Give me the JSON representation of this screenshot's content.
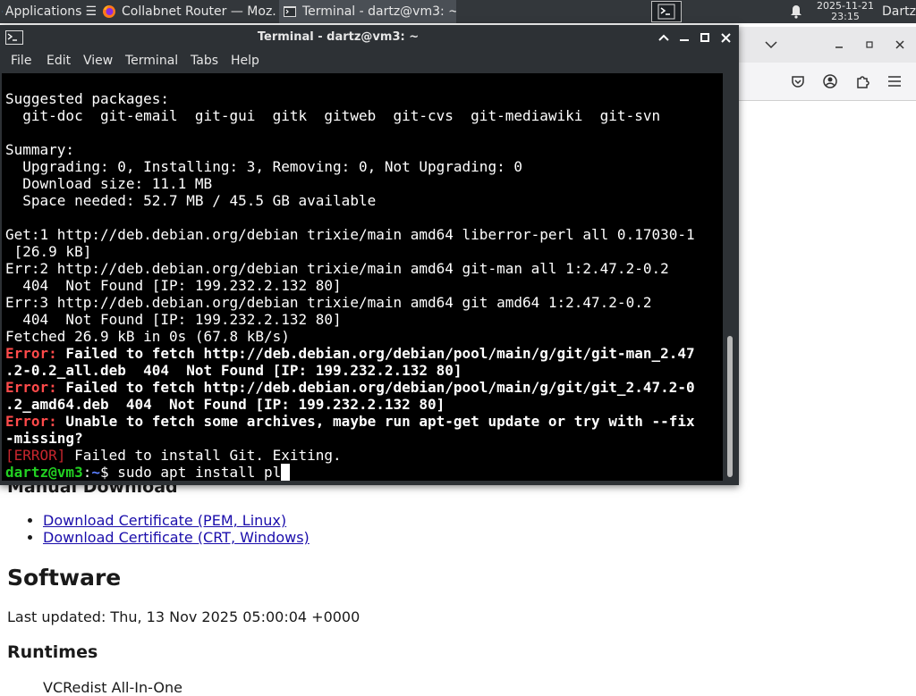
{
  "panel": {
    "applications": "Applications",
    "tasks": [
      {
        "title": "Collabnet Router — Moz...",
        "icon": "firefox-icon"
      },
      {
        "title": "Terminal - dartz@vm3: ~",
        "icon": "terminal-icon"
      }
    ],
    "clock_date": "2025-11-21",
    "clock_time": "23:15",
    "user": "Dartz"
  },
  "terminal": {
    "title": "Terminal - dartz@vm3: ~",
    "menu": [
      "File",
      "Edit",
      "View",
      "Terminal",
      "Tabs",
      "Help"
    ],
    "lines": {
      "l1": "Suggested packages:",
      "l2": "  git-doc  git-email  git-gui  gitk  gitweb  git-cvs  git-mediawiki  git-svn",
      "l3": "",
      "l4": "Summary:",
      "l5": "  Upgrading: 0, Installing: 3, Removing: 0, Not Upgrading: 0",
      "l6": "  Download size: 11.1 MB",
      "l7": "  Space needed: 52.7 MB / 45.5 GB available",
      "l8": "",
      "l9": "Get:1 http://deb.debian.org/debian trixie/main amd64 liberror-perl all 0.17030-1",
      "l10": " [26.9 kB]",
      "l11": "Err:2 http://deb.debian.org/debian trixie/main amd64 git-man all 1:2.47.2-0.2",
      "l12": "  404  Not Found [IP: 199.232.2.132 80]",
      "l13": "Err:3 http://deb.debian.org/debian trixie/main amd64 git amd64 1:2.47.2-0.2",
      "l14": "  404  Not Found [IP: 199.232.2.132 80]",
      "l15": "Fetched 26.9 kB in 0s (67.8 kB/s)",
      "error_label": "Error:",
      "e1a": " Failed to fetch http://deb.debian.org/debian/pool/main/g/git/git-man_2.47",
      "e1b": ".2-0.2_all.deb  404  Not Found [IP: 199.232.2.132 80]",
      "e2a": " Failed to fetch http://deb.debian.org/debian/pool/main/g/git/git_2.47.2-0",
      "e2b": ".2_amd64.deb  404  Not Found [IP: 199.232.2.132 80]",
      "e3a": " Unable to fetch some archives, maybe run apt-get update or try with --fix",
      "e3b": "-missing?",
      "err_tag": "[ERROR]",
      "err_msg": " Failed to install Git. Exiting.",
      "prompt_user": "dartz@vm3",
      "prompt_sep": ":",
      "prompt_path": "~",
      "prompt_sym": "$",
      "command": " sudo apt install pl"
    }
  },
  "firefox_page": {
    "section_partial": "Manual Download",
    "links": [
      "Download Certificate (PEM, Linux)",
      "Download Certificate (CRT, Windows)"
    ],
    "heading": "Software",
    "updated": "Last updated: Thu, 13 Nov 2025 05:00:04 +0000",
    "subheading": "Runtimes",
    "cut_item": "VCRedist All-In-One"
  }
}
